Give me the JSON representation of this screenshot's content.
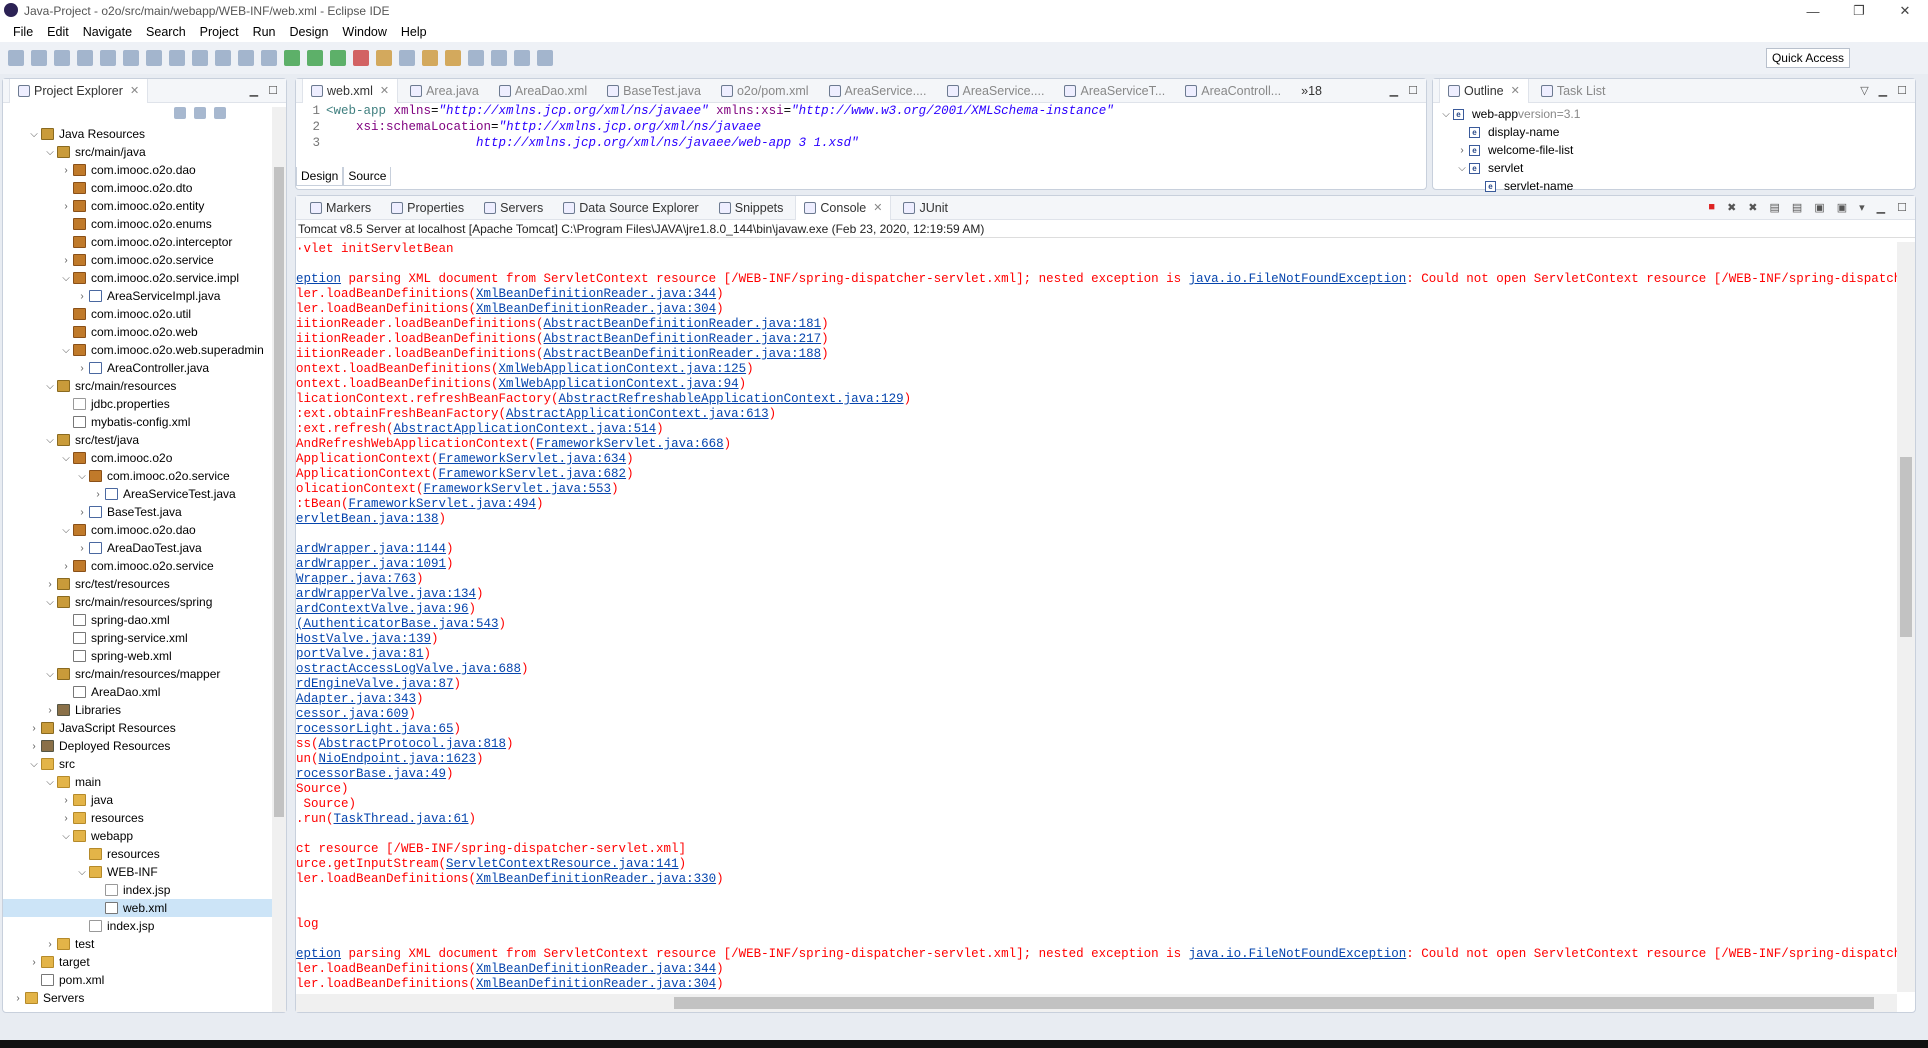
{
  "window": {
    "title": "Java-Project - o2o/src/main/webapp/WEB-INF/web.xml - Eclipse IDE",
    "min": "—",
    "max": "❐",
    "close": "✕"
  },
  "menu": [
    "File",
    "Edit",
    "Navigate",
    "Search",
    "Project",
    "Run",
    "Design",
    "Window",
    "Help"
  ],
  "toolbar": {
    "quick_access": "Quick Access"
  },
  "explorer": {
    "title": "Project Explorer",
    "items": [
      {
        "d": 1,
        "a": "v",
        "t": "src",
        "l": "Java Resources"
      },
      {
        "d": 2,
        "a": "v",
        "t": "src",
        "l": "src/main/java"
      },
      {
        "d": 3,
        "a": ">",
        "t": "pkg",
        "l": "com.imooc.o2o.dao"
      },
      {
        "d": 3,
        "a": "",
        "t": "pkg",
        "l": "com.imooc.o2o.dto"
      },
      {
        "d": 3,
        "a": ">",
        "t": "pkg",
        "l": "com.imooc.o2o.entity"
      },
      {
        "d": 3,
        "a": "",
        "t": "pkg",
        "l": "com.imooc.o2o.enums"
      },
      {
        "d": 3,
        "a": "",
        "t": "pkg",
        "l": "com.imooc.o2o.interceptor"
      },
      {
        "d": 3,
        "a": ">",
        "t": "pkg",
        "l": "com.imooc.o2o.service"
      },
      {
        "d": 3,
        "a": "v",
        "t": "pkg",
        "l": "com.imooc.o2o.service.impl"
      },
      {
        "d": 4,
        "a": ">",
        "t": "java",
        "l": "AreaServiceImpl.java"
      },
      {
        "d": 3,
        "a": "",
        "t": "pkg",
        "l": "com.imooc.o2o.util"
      },
      {
        "d": 3,
        "a": "",
        "t": "pkg",
        "l": "com.imooc.o2o.web"
      },
      {
        "d": 3,
        "a": "v",
        "t": "pkg",
        "l": "com.imooc.o2o.web.superadmin"
      },
      {
        "d": 4,
        "a": ">",
        "t": "java",
        "l": "AreaController.java"
      },
      {
        "d": 2,
        "a": "v",
        "t": "src",
        "l": "src/main/resources"
      },
      {
        "d": 3,
        "a": "",
        "t": "file",
        "l": "jdbc.properties"
      },
      {
        "d": 3,
        "a": "",
        "t": "xml",
        "l": "mybatis-config.xml"
      },
      {
        "d": 2,
        "a": "v",
        "t": "src",
        "l": "src/test/java"
      },
      {
        "d": 3,
        "a": "v",
        "t": "pkg",
        "l": "com.imooc.o2o"
      },
      {
        "d": 4,
        "a": "v",
        "t": "pkg",
        "l": "com.imooc.o2o.service"
      },
      {
        "d": 5,
        "a": ">",
        "t": "java",
        "l": "AreaServiceTest.java"
      },
      {
        "d": 4,
        "a": ">",
        "t": "java",
        "l": "BaseTest.java"
      },
      {
        "d": 3,
        "a": "v",
        "t": "pkg",
        "l": "com.imooc.o2o.dao"
      },
      {
        "d": 4,
        "a": ">",
        "t": "java",
        "l": "AreaDaoTest.java"
      },
      {
        "d": 3,
        "a": ">",
        "t": "pkg",
        "l": "com.imooc.o2o.service"
      },
      {
        "d": 2,
        "a": ">",
        "t": "src",
        "l": "src/test/resources"
      },
      {
        "d": 2,
        "a": "v",
        "t": "src",
        "l": "src/main/resources/spring"
      },
      {
        "d": 3,
        "a": "",
        "t": "xml",
        "l": "spring-dao.xml"
      },
      {
        "d": 3,
        "a": "",
        "t": "xml",
        "l": "spring-service.xml"
      },
      {
        "d": 3,
        "a": "",
        "t": "xml",
        "l": "spring-web.xml"
      },
      {
        "d": 2,
        "a": "v",
        "t": "src",
        "l": "src/main/resources/mapper"
      },
      {
        "d": 3,
        "a": "",
        "t": "xml",
        "l": "AreaDao.xml"
      },
      {
        "d": 2,
        "a": ">",
        "t": "lib",
        "l": "Libraries"
      },
      {
        "d": 1,
        "a": ">",
        "t": "src",
        "l": "JavaScript Resources"
      },
      {
        "d": 1,
        "a": ">",
        "t": "lib",
        "l": "Deployed Resources"
      },
      {
        "d": 1,
        "a": "v",
        "t": "folder",
        "l": "src"
      },
      {
        "d": 2,
        "a": "v",
        "t": "folder",
        "l": "main"
      },
      {
        "d": 3,
        "a": ">",
        "t": "folder",
        "l": "java"
      },
      {
        "d": 3,
        "a": ">",
        "t": "folder",
        "l": "resources"
      },
      {
        "d": 3,
        "a": "v",
        "t": "folder",
        "l": "webapp"
      },
      {
        "d": 4,
        "a": "",
        "t": "folder",
        "l": "resources"
      },
      {
        "d": 4,
        "a": "v",
        "t": "folder",
        "l": "WEB-INF"
      },
      {
        "d": 5,
        "a": "",
        "t": "file",
        "l": "index.jsp"
      },
      {
        "d": 5,
        "a": "",
        "t": "xml",
        "l": "web.xml",
        "selected": true
      },
      {
        "d": 4,
        "a": "",
        "t": "file",
        "l": "index.jsp"
      },
      {
        "d": 2,
        "a": ">",
        "t": "folder",
        "l": "test"
      },
      {
        "d": 1,
        "a": ">",
        "t": "folder",
        "l": "target"
      },
      {
        "d": 1,
        "a": "",
        "t": "xml",
        "l": "pom.xml"
      },
      {
        "d": 0,
        "a": ">",
        "t": "folder",
        "l": "Servers"
      }
    ]
  },
  "editor": {
    "tabs": [
      "web.xml",
      "Area.java",
      "AreaDao.xml",
      "BaseTest.java",
      "o2o/pom.xml",
      "AreaService....",
      "AreaService....",
      "AreaServiceT...",
      "AreaControll..."
    ],
    "active_tab": 0,
    "overflow": "»18",
    "lines": [
      {
        "n": "1",
        "parts": [
          [
            "tag",
            "<web-app "
          ],
          [
            "attr",
            "xmlns"
          ],
          [
            "",
            "="
          ],
          [
            "val",
            "\"http://xmlns.jcp.org/xml/ns/javaee\""
          ],
          [
            "",
            " "
          ],
          [
            "attr",
            "xmlns:xsi"
          ],
          [
            "",
            "="
          ],
          [
            "val",
            "\"http://www.w3.org/2001/XMLSchema-instance\""
          ]
        ]
      },
      {
        "n": "2",
        "parts": [
          [
            "",
            "    "
          ],
          [
            "attr",
            "xsi:schemaLocation"
          ],
          [
            "",
            "="
          ],
          [
            "val",
            "\"http://xmlns.jcp.org/xml/ns/javaee"
          ]
        ]
      },
      {
        "n": "3",
        "parts": [
          [
            "",
            "                    "
          ],
          [
            "val",
            "http://xmlns.jcp.org/xml/ns/javaee/web-app 3 1.xsd\""
          ]
        ]
      }
    ],
    "design_tab": "Design",
    "source_tab": "Source"
  },
  "outline": {
    "tabs": [
      "Outline",
      "Task List"
    ],
    "items": [
      {
        "d": 0,
        "a": "v",
        "l": "web-app",
        "extra": " version=3.1"
      },
      {
        "d": 1,
        "a": "",
        "l": "display-name"
      },
      {
        "d": 1,
        "a": ">",
        "l": "welcome-file-list"
      },
      {
        "d": 1,
        "a": "v",
        "l": "servlet"
      },
      {
        "d": 2,
        "a": "",
        "l": "servlet-name"
      }
    ]
  },
  "console": {
    "tabs": [
      "Markers",
      "Properties",
      "Servers",
      "Data Source Explorer",
      "Snippets",
      "Console",
      "JUnit"
    ],
    "active_tab": 5,
    "header": "Tomcat v8.5 Server at localhost [Apache Tomcat] C:\\Program Files\\JAVA\\jre1.8.0_144\\bin\\javaw.exe (Feb 23, 2020, 12:19:59 AM)",
    "lines": [
      [
        [
          "t",
          "·vlet initServletBean"
        ]
      ],
      [],
      [
        [
          "a",
          "eption"
        ],
        [
          "t",
          " parsing XML document from ServletContext resource [/WEB-INF/spring-dispatcher-servlet.xml]; nested exception is "
        ],
        [
          "a",
          "java.io.FileNotFoundException"
        ],
        [
          "t",
          ": Could not open ServletContext resource [/WEB-INF/spring-dispatcher-servlet.xml]"
        ]
      ],
      [
        [
          "t",
          "ler.loadBeanDefinitions("
        ],
        [
          "a",
          "XmlBeanDefinitionReader.java:344"
        ],
        [
          "t",
          ")"
        ]
      ],
      [
        [
          "t",
          "ler.loadBeanDefinitions("
        ],
        [
          "a",
          "XmlBeanDefinitionReader.java:304"
        ],
        [
          "t",
          ")"
        ]
      ],
      [
        [
          "t",
          "iitionReader.loadBeanDefinitions("
        ],
        [
          "a",
          "AbstractBeanDefinitionReader.java:181"
        ],
        [
          "t",
          ")"
        ]
      ],
      [
        [
          "t",
          "iitionReader.loadBeanDefinitions("
        ],
        [
          "a",
          "AbstractBeanDefinitionReader.java:217"
        ],
        [
          "t",
          ")"
        ]
      ],
      [
        [
          "t",
          "iitionReader.loadBeanDefinitions("
        ],
        [
          "a",
          "AbstractBeanDefinitionReader.java:188"
        ],
        [
          "t",
          ")"
        ]
      ],
      [
        [
          "t",
          "ontext.loadBeanDefinitions("
        ],
        [
          "a",
          "XmlWebApplicationContext.java:125"
        ],
        [
          "t",
          ")"
        ]
      ],
      [
        [
          "t",
          "ontext.loadBeanDefinitions("
        ],
        [
          "a",
          "XmlWebApplicationContext.java:94"
        ],
        [
          "t",
          ")"
        ]
      ],
      [
        [
          "t",
          "licationContext.refreshBeanFactory("
        ],
        [
          "a",
          "AbstractRefreshableApplicationContext.java:129"
        ],
        [
          "t",
          ")"
        ]
      ],
      [
        [
          "t",
          ":ext.obtainFreshBeanFactory("
        ],
        [
          "a",
          "AbstractApplicationContext.java:613"
        ],
        [
          "t",
          ")"
        ]
      ],
      [
        [
          "t",
          ":ext.refresh("
        ],
        [
          "a",
          "AbstractApplicationContext.java:514"
        ],
        [
          "t",
          ")"
        ]
      ],
      [
        [
          "t",
          "AndRefreshWebApplicationContext("
        ],
        [
          "a",
          "FrameworkServlet.java:668"
        ],
        [
          "t",
          ")"
        ]
      ],
      [
        [
          "t",
          "ApplicationContext("
        ],
        [
          "a",
          "FrameworkServlet.java:634"
        ],
        [
          "t",
          ")"
        ]
      ],
      [
        [
          "t",
          "ApplicationContext("
        ],
        [
          "a",
          "FrameworkServlet.java:682"
        ],
        [
          "t",
          ")"
        ]
      ],
      [
        [
          "t",
          "olicationContext("
        ],
        [
          "a",
          "FrameworkServlet.java:553"
        ],
        [
          "t",
          ")"
        ]
      ],
      [
        [
          "t",
          ":tBean("
        ],
        [
          "a",
          "FrameworkServlet.java:494"
        ],
        [
          "t",
          ")"
        ]
      ],
      [
        [
          "a",
          "ervletBean.java:138"
        ],
        [
          "t",
          ")"
        ]
      ],
      [],
      [
        [
          "a",
          "ardWrapper.java:1144"
        ],
        [
          "t",
          ")"
        ]
      ],
      [
        [
          "a",
          "ardWrapper.java:1091"
        ],
        [
          "t",
          ")"
        ]
      ],
      [
        [
          "a",
          "Wrapper.java:763"
        ],
        [
          "t",
          ")"
        ]
      ],
      [
        [
          "a",
          "ardWrapperValve.java:134"
        ],
        [
          "t",
          ")"
        ]
      ],
      [
        [
          "a",
          "ardContextValve.java:96"
        ],
        [
          "t",
          ")"
        ]
      ],
      [
        [
          "a",
          "(AuthenticatorBase.java:543"
        ],
        [
          "t",
          ")"
        ]
      ],
      [
        [
          "a",
          "HostValve.java:139"
        ],
        [
          "t",
          ")"
        ]
      ],
      [
        [
          "a",
          "portValve.java:81"
        ],
        [
          "t",
          ")"
        ]
      ],
      [
        [
          "a",
          "ostractAccessLogValve.java:688"
        ],
        [
          "t",
          ")"
        ]
      ],
      [
        [
          "a",
          "rdEngineValve.java:87"
        ],
        [
          "t",
          ")"
        ]
      ],
      [
        [
          "a",
          "Adapter.java:343"
        ],
        [
          "t",
          ")"
        ]
      ],
      [
        [
          "a",
          "cessor.java:609"
        ],
        [
          "t",
          ")"
        ]
      ],
      [
        [
          "a",
          "rocessorLight.java:65"
        ],
        [
          "t",
          ")"
        ]
      ],
      [
        [
          "t",
          "ss("
        ],
        [
          "a",
          "AbstractProtocol.java:818"
        ],
        [
          "t",
          ")"
        ]
      ],
      [
        [
          "t",
          "un("
        ],
        [
          "a",
          "NioEndpoint.java:1623"
        ],
        [
          "t",
          ")"
        ]
      ],
      [
        [
          "a",
          "rocessorBase.java:49"
        ],
        [
          "t",
          ")"
        ]
      ],
      [
        [
          "t",
          "Source)"
        ]
      ],
      [
        [
          "t",
          " Source)"
        ]
      ],
      [
        [
          "t",
          ".run("
        ],
        [
          "a",
          "TaskThread.java:61"
        ],
        [
          "t",
          ")"
        ]
      ],
      [],
      [
        [
          "t",
          "ct resource [/WEB-INF/spring-dispatcher-servlet.xml]"
        ]
      ],
      [
        [
          "t",
          "urce.getInputStream("
        ],
        [
          "a",
          "ServletContextResource.java:141"
        ],
        [
          "t",
          ")"
        ]
      ],
      [
        [
          "t",
          "ler.loadBeanDefinitions("
        ],
        [
          "a",
          "XmlBeanDefinitionReader.java:330"
        ],
        [
          "t",
          ")"
        ]
      ],
      [],
      [],
      [
        [
          "t",
          "log"
        ]
      ],
      [],
      [
        [
          "a",
          "eption"
        ],
        [
          "t",
          " parsing XML document from ServletContext resource [/WEB-INF/spring-dispatcher-servlet.xml]; nested exception is "
        ],
        [
          "a",
          "java.io.FileNotFoundException"
        ],
        [
          "t",
          ": Could not open ServletContext resource [/WEB-INF/spring-dispatcher-servlet.xml]"
        ]
      ],
      [
        [
          "t",
          "ler.loadBeanDefinitions("
        ],
        [
          "a",
          "XmlBeanDefinitionReader.java:344"
        ],
        [
          "t",
          ")"
        ]
      ],
      [
        [
          "t",
          "ler.loadBeanDefinitions("
        ],
        [
          "a",
          "XmlBeanDefinitionReader.java:304"
        ],
        [
          "t",
          ")"
        ]
      ]
    ]
  },
  "colors": {
    "error_text": "#ff0000",
    "link": "#0645ad",
    "selection": "#cce4f7"
  }
}
